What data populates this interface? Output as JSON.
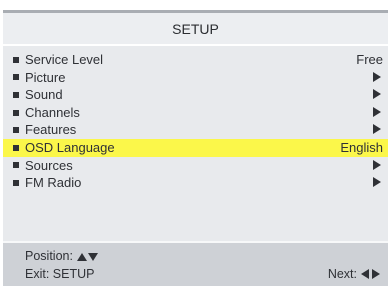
{
  "header": {
    "title": "SETUP"
  },
  "menu": {
    "items": [
      {
        "label": "Service Level",
        "value": "Free",
        "has_arrow": false,
        "selected": false
      },
      {
        "label": "Picture",
        "value": "",
        "has_arrow": true,
        "selected": false
      },
      {
        "label": "Sound",
        "value": "",
        "has_arrow": true,
        "selected": false
      },
      {
        "label": "Channels",
        "value": "",
        "has_arrow": true,
        "selected": false
      },
      {
        "label": "Features",
        "value": "",
        "has_arrow": true,
        "selected": false
      },
      {
        "label": "OSD Language",
        "value": "English",
        "has_arrow": false,
        "selected": true
      },
      {
        "label": "Sources",
        "value": "",
        "has_arrow": true,
        "selected": false
      },
      {
        "label": "FM Radio",
        "value": "",
        "has_arrow": true,
        "selected": false
      }
    ]
  },
  "footer": {
    "position_label": "Position:",
    "exit_label": "Exit: SETUP",
    "next_label": "Next:"
  },
  "colors": {
    "highlight": "#fbf74a",
    "panel": "#e8eaed",
    "footer": "#ced1d6",
    "text": "#2f3136"
  },
  "icons": {
    "bullet": "square-bullet-icon",
    "submenu": "arrow-right-icon",
    "position": [
      "arrow-up-icon",
      "arrow-down-icon"
    ],
    "next": [
      "arrow-left-icon",
      "arrow-right-icon"
    ]
  }
}
